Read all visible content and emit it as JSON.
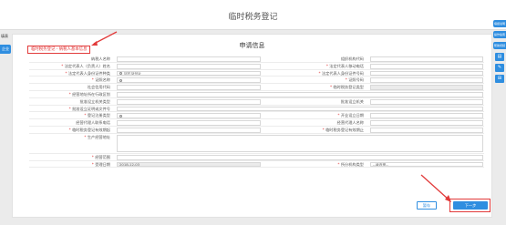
{
  "header": {
    "title": "临时税务登记"
  },
  "left_tabs": {
    "label": "填表",
    "active_tab": "企业"
  },
  "panel": {
    "tag": "临时税务登记 - 纳税人基本信息",
    "title": "申请信息"
  },
  "form": {
    "rows": [
      {
        "l1": "纳税人名称",
        "r1": false,
        "v1": "",
        "l2": "组织机构代码",
        "r2": false,
        "v2": ""
      },
      {
        "l1": "法定代表人（负责人）姓名",
        "r1": true,
        "v1": "",
        "l2": "法定代表人移动电话",
        "r2": true,
        "v2": ""
      },
      {
        "l1": "法定代表人身份证件种类",
        "r1": true,
        "v1": "居民身份证",
        "search1": true,
        "l2": "法定代表人身份证件号码",
        "r2": true,
        "v2": ""
      },
      {
        "l1": "证照名称",
        "r1": true,
        "v1": "",
        "search1": true,
        "l2": "证照号码",
        "r2": true,
        "v2": ""
      },
      {
        "l1": "社会信用代码",
        "r1": false,
        "v1": "",
        "l2": "临时税务登记类型",
        "r2": true,
        "v2": "",
        "gray2": true
      },
      {
        "l1": "经营地址所在行政区划",
        "r1": true,
        "v1": "",
        "wide": true
      },
      {
        "l1": "批准设立机关类型",
        "r1": false,
        "v1": "",
        "l2": "批准设立机关",
        "r2": false,
        "v2": ""
      },
      {
        "l1": "批准设立证明或文件号",
        "r1": true,
        "v1": "",
        "wide": true
      },
      {
        "l1": "登记注册类型",
        "r1": true,
        "v1": "",
        "search1": true,
        "l2": "开业设立日期",
        "r2": true,
        "v2": ""
      },
      {
        "l1": "经营代理人联系电话",
        "r1": false,
        "v1": "",
        "l2": "经营代理人名称",
        "r2": false,
        "v2": ""
      },
      {
        "l1": "临时税务登记有效期起",
        "r1": true,
        "v1": "",
        "l2": "临时税务登记有效期止",
        "r2": true,
        "v2": ""
      },
      {
        "l1": "生产经营地址",
        "r1": true,
        "v1": "",
        "wide": true,
        "tall": true
      },
      {
        "l1": "经营范围",
        "r1": true,
        "v1": "",
        "wide": true
      },
      {
        "l1": "受理日期",
        "r1": true,
        "v1": "2018-12-03",
        "gray1": true,
        "l2": "所分机构类型",
        "r2": true,
        "v2": "--请选择--",
        "select2": true
      }
    ]
  },
  "buttons": {
    "save": "暂存",
    "next": "下一步"
  },
  "right_tools": {
    "btn1": "填报说明",
    "btn2": "操作指南",
    "btn3": "帮助视频"
  },
  "colors": {
    "accent": "#2f8ee0",
    "annotation": "#e23a3a"
  }
}
